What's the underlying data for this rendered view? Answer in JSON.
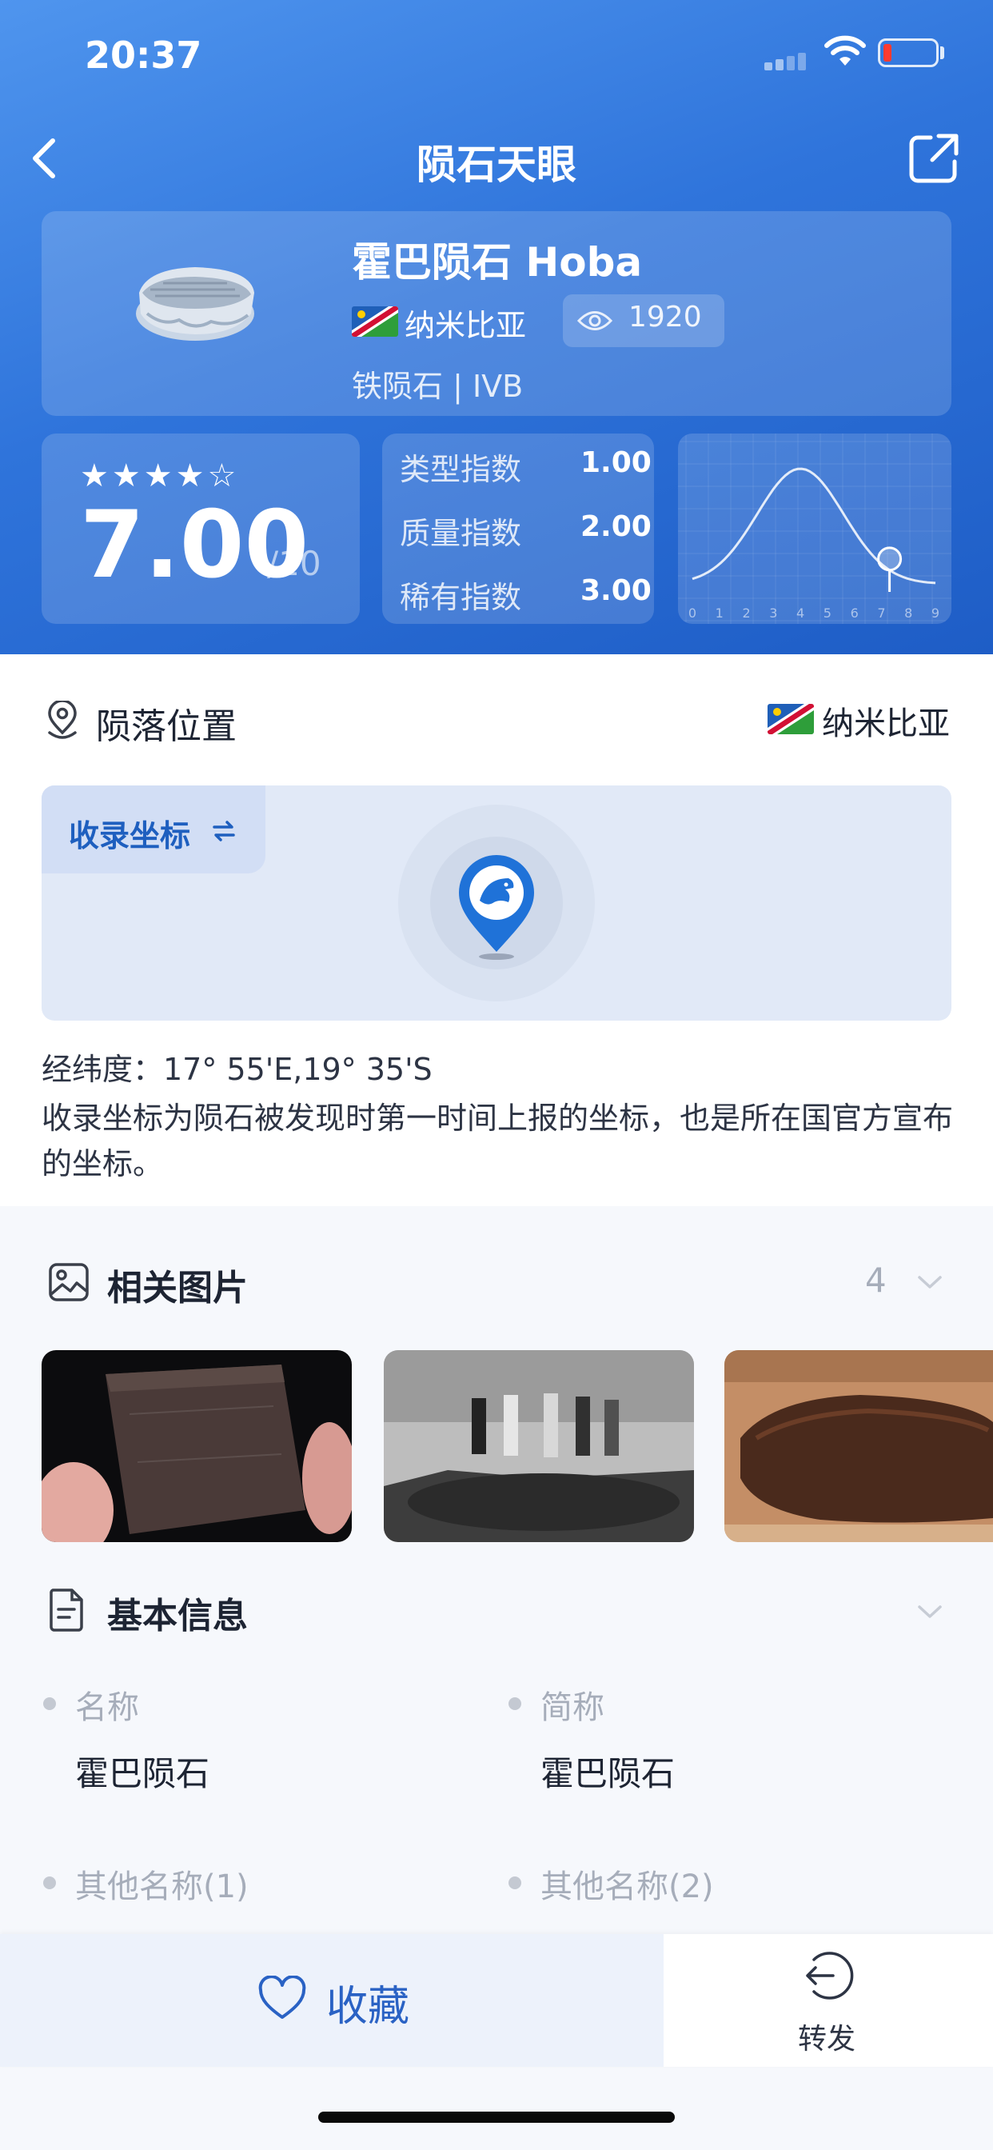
{
  "status_bar": {
    "time": "20:37"
  },
  "nav": {
    "title": "陨石天眼"
  },
  "meteorite": {
    "name": "霍巴陨石 Hoba",
    "country": "纳米比亚",
    "views": "1920",
    "classification": "铁陨石 | IVB"
  },
  "rating": {
    "stars_filled": 4,
    "stars_total": 5,
    "stars_text": "★★★★☆",
    "score": "7.00",
    "max": "/10"
  },
  "indices": [
    {
      "label": "类型指数",
      "value": "1.00"
    },
    {
      "label": "质量指数",
      "value": "2.00"
    },
    {
      "label": "稀有指数",
      "value": "3.00"
    }
  ],
  "chart_data": {
    "type": "line",
    "title": "",
    "xlabel": "",
    "ylabel": "",
    "x_ticks": [
      "0",
      "1",
      "2",
      "3",
      "4",
      "5",
      "6",
      "7",
      "8",
      "9"
    ],
    "xlim": [
      0,
      9
    ],
    "series": [
      {
        "shape": "bell-curve",
        "peak_x": 4,
        "marker_x": 7.3
      }
    ],
    "grid": true
  },
  "location": {
    "section_title": "陨落位置",
    "country": "纳米比亚",
    "coord_tab": "收录坐标",
    "latlng": "经纬度：17° 55'E,19° 35'S",
    "description": "收录坐标为陨石被发现时第一时间上报的坐标，也是所在国官方宣布的坐标。"
  },
  "photos": {
    "section_title": "相关图片",
    "count": "4"
  },
  "basic_info": {
    "section_title": "基本信息",
    "fields": [
      {
        "label": "名称",
        "value": "霍巴陨石"
      },
      {
        "label": "简称",
        "value": "霍巴陨石"
      },
      {
        "label": "其他名称(1)",
        "value": ""
      },
      {
        "label": "其他名称(2)",
        "value": ""
      }
    ]
  },
  "bottom": {
    "favorite_label": "收藏",
    "forward_label": "转发"
  },
  "colors": {
    "header_gradient_start": "#4f95ee",
    "header_gradient_end": "#1e5dc6",
    "accent_blue": "#2a62c4",
    "muted_text": "#a6adba"
  },
  "icons": [
    "back-icon",
    "share-icon",
    "eye-icon",
    "location-pin-icon",
    "refresh-icon",
    "map-pin-eagle-icon",
    "image-icon",
    "document-icon",
    "chevron-down-icon",
    "heart-icon",
    "forward-icon"
  ]
}
